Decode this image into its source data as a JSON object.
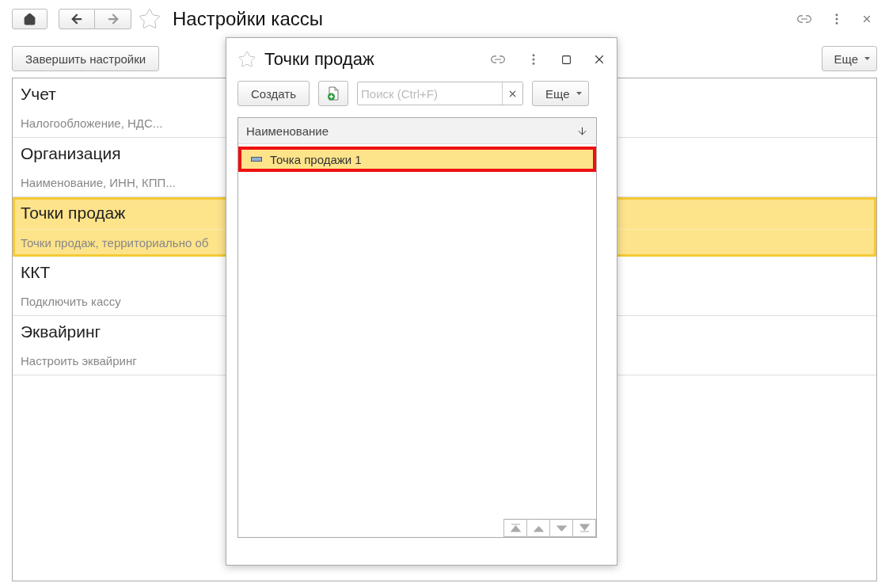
{
  "window": {
    "title": "Настройки кассы"
  },
  "toolbar": {
    "finish_button": "Завершить настройки",
    "more_button": "Еще"
  },
  "sections": [
    {
      "title": "Учет",
      "description": "Налогообложение, НДС...",
      "selected": false
    },
    {
      "title": "Организация",
      "description": "Наименование, ИНН, КПП...",
      "selected": false
    },
    {
      "title": "Точки продаж",
      "description": "Точки продаж, территориально об",
      "selected": true
    },
    {
      "title": "ККТ",
      "description": "Подключить кассу",
      "selected": false
    },
    {
      "title": "Эквайринг",
      "description": "Настроить эквайринг",
      "selected": false
    }
  ],
  "dialog": {
    "title": "Точки продаж",
    "create_button": "Создать",
    "search": {
      "placeholder": "Поиск (Ctrl+F)"
    },
    "more_button": "Еще",
    "table": {
      "columns": [
        "Наименование"
      ],
      "rows": [
        {
          "name": "Точка продажи 1",
          "selected": true,
          "outlined": true
        }
      ]
    }
  }
}
